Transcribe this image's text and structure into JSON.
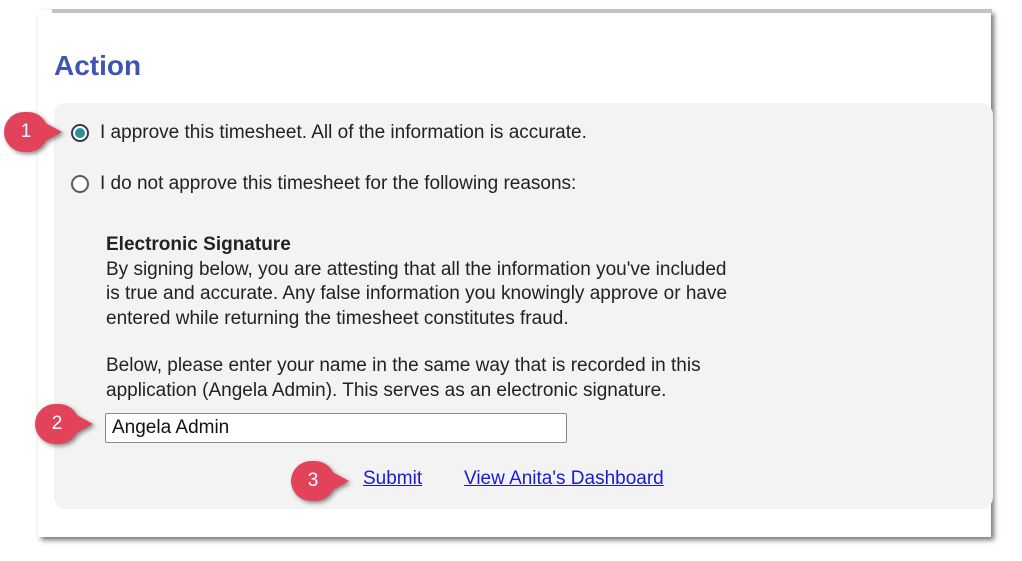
{
  "section": {
    "title": "Action"
  },
  "options": [
    {
      "label": "I approve this timesheet. All of the information is accurate.",
      "selected": true
    },
    {
      "label": "I do not approve this timesheet for the following reasons:",
      "selected": false
    }
  ],
  "signature": {
    "title": "Electronic Signature",
    "paragraph1": "By signing below, you are attesting that all the information you've included\nis true and accurate. Any false information you knowingly approve or have\nentered while returning the timesheet constitutes fraud.",
    "paragraph2": "Below, please enter your name in the same way that is recorded in this\napplication (Angela Admin). This serves as an electronic signature.",
    "input_value": "Angela Admin"
  },
  "links": {
    "submit": "Submit",
    "dashboard": "View Anita's Dashboard"
  },
  "callouts": [
    "1",
    "2",
    "3"
  ],
  "colors": {
    "heading": "#3f55b3",
    "link": "#1a1ad6",
    "callout": "#e2425a",
    "radio_selected": "#2e8e92"
  }
}
